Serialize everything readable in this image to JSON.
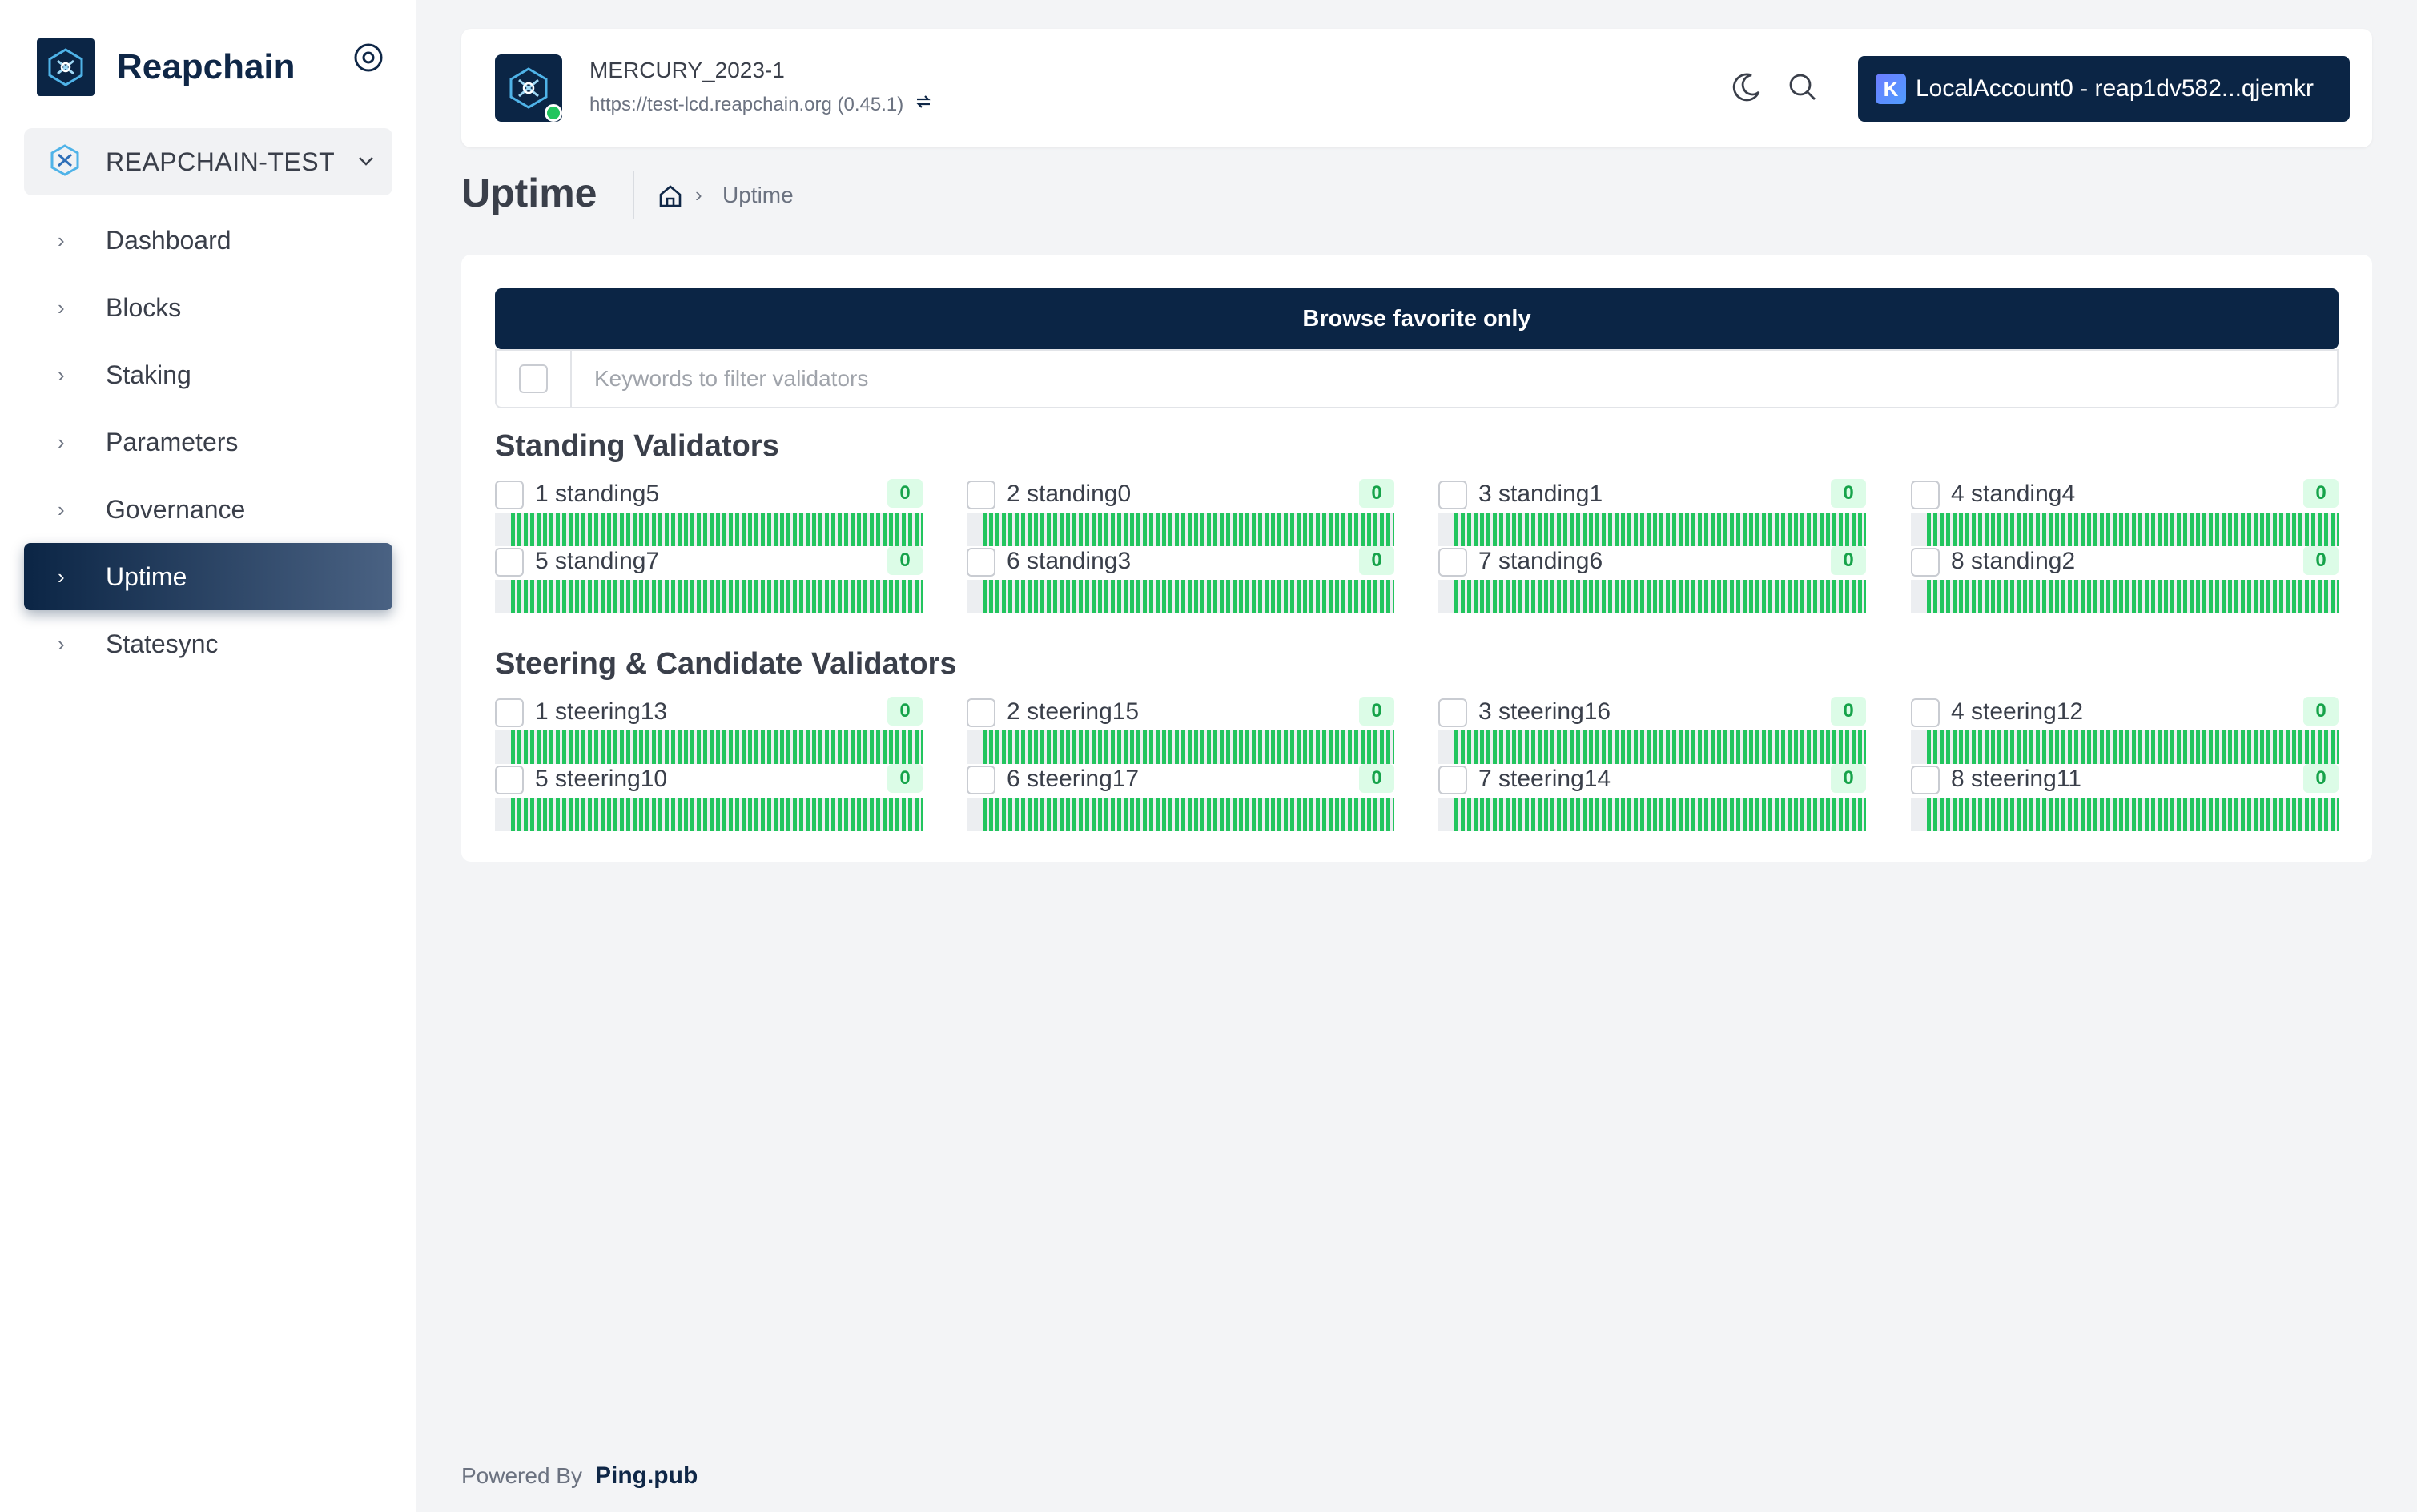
{
  "sidebar": {
    "brand": "Reapchain",
    "chain_selector": "REAPCHAIN-TEST",
    "items": [
      {
        "label": "Dashboard"
      },
      {
        "label": "Blocks"
      },
      {
        "label": "Staking"
      },
      {
        "label": "Parameters"
      },
      {
        "label": "Governance"
      },
      {
        "label": "Uptime"
      },
      {
        "label": "Statesync"
      }
    ],
    "active": "Uptime"
  },
  "header": {
    "network_name": "MERCURY_2023-1",
    "endpoint": "https://test-lcd.reapchain.org (0.45.1)",
    "status_color": "#22c55e",
    "account_badge": "K",
    "account_label": "LocalAccount0 - reap1dv582...qjemkr"
  },
  "page": {
    "title": "Uptime",
    "breadcrumb_current": "Uptime"
  },
  "controls": {
    "favorite_button": "Browse favorite only",
    "filter_placeholder": "Keywords to filter validators"
  },
  "standing": {
    "title": "Standing Validators",
    "validators": [
      {
        "label": "1 standing5",
        "missed": "0"
      },
      {
        "label": "2 standing0",
        "missed": "0"
      },
      {
        "label": "3 standing1",
        "missed": "0"
      },
      {
        "label": "4 standing4",
        "missed": "0"
      },
      {
        "label": "5 standing7",
        "missed": "0"
      },
      {
        "label": "6 standing3",
        "missed": "0"
      },
      {
        "label": "7 standing6",
        "missed": "0"
      },
      {
        "label": "8 standing2",
        "missed": "0"
      }
    ]
  },
  "steering": {
    "title": "Steering & Candidate Validators",
    "validators": [
      {
        "label": "1 steering13",
        "missed": "0"
      },
      {
        "label": "2 steering15",
        "missed": "0"
      },
      {
        "label": "3 steering16",
        "missed": "0"
      },
      {
        "label": "4 steering12",
        "missed": "0"
      },
      {
        "label": "5 steering10",
        "missed": "0"
      },
      {
        "label": "6 steering17",
        "missed": "0"
      },
      {
        "label": "7 steering14",
        "missed": "0"
      },
      {
        "label": "8 steering11",
        "missed": "0"
      }
    ]
  },
  "uptime_fill": 1.0,
  "colors": {
    "accent": "#0b2545",
    "uptime_bar": "#22c55e",
    "badge_bg": "#dcfce7",
    "badge_text": "#16a34a"
  },
  "footer": {
    "prefix": "Powered By",
    "brand": "Ping.pub"
  }
}
